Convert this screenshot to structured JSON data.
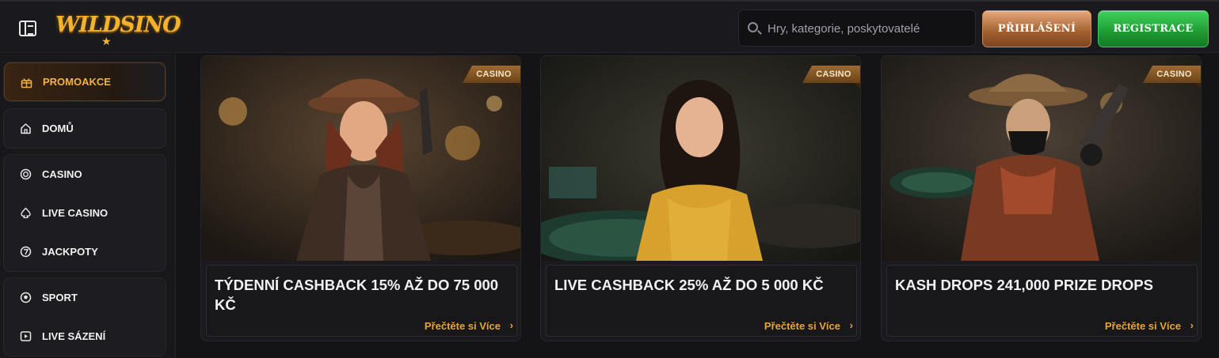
{
  "header": {
    "logo_text": "WILDSINO",
    "search_placeholder": "Hry, kategorie, poskytovatelé",
    "login_label": "PŘIHLÁŠENÍ",
    "register_label": "REGISTRACE"
  },
  "sidebar": {
    "items": [
      {
        "label": "PROMOAKCE",
        "icon": "gift-icon",
        "active": true
      },
      {
        "label": "DOMŮ",
        "icon": "home-icon"
      },
      {
        "label": "CASINO",
        "icon": "chip-icon"
      },
      {
        "label": "LIVE CASINO",
        "icon": "spade-icon"
      },
      {
        "label": "JACKPOTY",
        "icon": "jackpot-7-icon"
      },
      {
        "label": "SPORT",
        "icon": "ball-icon"
      },
      {
        "label": "LIVE SÁZENÍ",
        "icon": "play-icon"
      }
    ]
  },
  "promos": [
    {
      "badge": "CASINO",
      "title": "TÝDENNÍ CASHBACK 15% AŽ DO 75 000 KČ",
      "link": "Přečtěte si Více"
    },
    {
      "badge": "CASINO",
      "title": "LIVE CASHBACK 25% AŽ DO 5 000 KČ",
      "link": "Přečtěte si Více"
    },
    {
      "badge": "CASINO",
      "title": "KASH DROPS 241,000 PRIZE DROPS",
      "link": "Přečtěte si Více"
    }
  ],
  "colors": {
    "accent": "#f4b241",
    "login_button": "#a05f2e",
    "register_button": "#1f9a33",
    "background": "#141417"
  }
}
